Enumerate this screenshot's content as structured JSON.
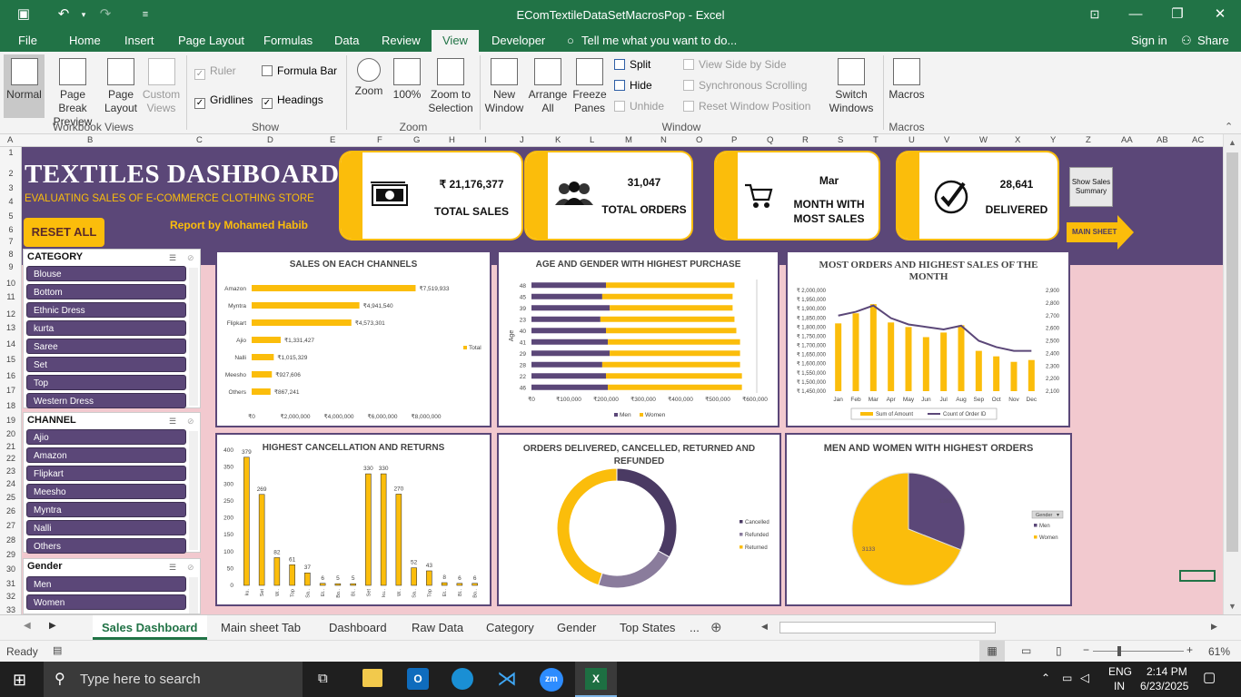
{
  "window": {
    "title": "EComTextileDataSetMacrosPop - Excel"
  },
  "menu": {
    "file": "File",
    "tabs": [
      "Home",
      "Insert",
      "Page Layout",
      "Formulas",
      "Data",
      "Review",
      "View",
      "Developer"
    ],
    "tell_me": "Tell me what you want to do...",
    "sign_in": "Sign in",
    "share": "Share"
  },
  "ribbon": {
    "normal": "Normal",
    "page_break": "Page Break Preview",
    "page_layout": "Page Layout",
    "custom_views": "Custom Views",
    "workbook_views": "Workbook Views",
    "ruler": "Ruler",
    "formula_bar": "Formula Bar",
    "gridlines": "Gridlines",
    "headings": "Headings",
    "show": "Show",
    "zoom": "Zoom",
    "zoom100": "100%",
    "zoom_sel": "Zoom to Selection",
    "zoom_grp": "Zoom",
    "new_window": "New Window",
    "arrange_all": "Arrange All",
    "freeze": "Freeze Panes",
    "split": "Split",
    "hide": "Hide",
    "unhide": "Unhide",
    "side_by_side": "View Side by Side",
    "sync_scroll": "Synchronous Scrolling",
    "reset_pos": "Reset Window Position",
    "switch_windows": "Switch Windows",
    "window_grp": "Window",
    "macros": "Macros",
    "macros_grp": "Macros"
  },
  "columns": [
    "A",
    "B",
    "C",
    "D",
    "E",
    "F",
    "G",
    "H",
    "I",
    "J",
    "K",
    "L",
    "M",
    "N",
    "O",
    "P",
    "Q",
    "R",
    "S",
    "T",
    "U",
    "V",
    "W",
    "X",
    "Y",
    "Z",
    "AA",
    "AB",
    "AC"
  ],
  "rows": [
    "1",
    "2",
    "3",
    "4",
    "5",
    "6",
    "7",
    "8",
    "9",
    "10",
    "11",
    "12",
    "13",
    "14",
    "15",
    "16",
    "17",
    "18",
    "19",
    "20",
    "21",
    "22",
    "23",
    "24",
    "25",
    "26",
    "27",
    "28",
    "29",
    "30",
    "31",
    "32",
    "33",
    "34",
    "35",
    "36",
    "37",
    "38",
    "39",
    "40"
  ],
  "dashboard": {
    "title": "TEXTILES DASHBOARD",
    "subtitle": "EVALUATING SALES OF E-COMMERCE  CLOTHING STORE",
    "reset": "RESET ALL",
    "author": "Report by Mohamed Habib",
    "kpis": [
      {
        "value": "₹ 21,176,377",
        "label": "TOTAL SALES",
        "icon": "money-icon"
      },
      {
        "value": "31,047",
        "label": "TOTAL ORDERS",
        "icon": "people-icon"
      },
      {
        "value": "Mar",
        "label": "MONTH WITH MOST SALES",
        "icon": "cart-icon"
      },
      {
        "value": "28,641",
        "label": "DELIVERED",
        "icon": "checkmark-icon"
      }
    ],
    "show_summary": "Show Sales Summary",
    "main_sheet": "MAIN SHEET"
  },
  "slicers": {
    "category": {
      "title": "CATEGORY",
      "items": [
        "Blouse",
        "Bottom",
        "Ethnic Dress",
        "kurta",
        "Saree",
        "Set",
        "Top",
        "Western Dress"
      ]
    },
    "channel": {
      "title": "CHANNEL",
      "items": [
        "Ajio",
        "Amazon",
        "Flipkart",
        "Meesho",
        "Myntra",
        "Nalli",
        "Others"
      ]
    },
    "gender": {
      "title": "Gender",
      "items": [
        "Men",
        "Women"
      ]
    }
  },
  "chart_data": [
    {
      "type": "bar",
      "title": "SALES ON EACH CHANNELS",
      "categories": [
        "Amazon",
        "Myntra",
        "Flipkart",
        "Ajio",
        "Nalli",
        "Meesho",
        "Others"
      ],
      "values": [
        7519933,
        4941540,
        4573301,
        1331427,
        1015329,
        927606,
        867241
      ],
      "labels": [
        "₹7,519,933",
        "₹4,941,540",
        "₹4,573,301",
        "₹1,331,427",
        "₹1,015,329",
        "₹927,606",
        "₹867,241"
      ],
      "xticks": [
        "₹0",
        "₹2,000,000",
        "₹4,000,000",
        "₹6,000,000",
        "₹8,000,000"
      ],
      "xlim": [
        0,
        8000000
      ],
      "legend": "Total",
      "color": "#fbbd0b"
    },
    {
      "type": "bar",
      "stacked": true,
      "title": "AGE AND GENDER WITH HIGHEST PURCHASE",
      "ylabel": "Age",
      "categories": [
        "48",
        "45",
        "39",
        "23",
        "40",
        "41",
        "29",
        "28",
        "22",
        "46"
      ],
      "series": [
        {
          "name": "Men",
          "values": [
            200000,
            190000,
            210000,
            185000,
            200000,
            205000,
            210000,
            190000,
            200000,
            205000
          ],
          "color": "#5b4778"
        },
        {
          "name": "Women",
          "values": [
            345000,
            350000,
            330000,
            360000,
            350000,
            355000,
            350000,
            370000,
            365000,
            360000
          ],
          "color": "#fbbd0b"
        }
      ],
      "xticks": [
        "₹0",
        "₹100,000",
        "₹200,000",
        "₹300,000",
        "₹400,000",
        "₹500,000",
        "₹600,000"
      ],
      "xlim": [
        0,
        600000
      ]
    },
    {
      "type": "bar+line",
      "title": "MOST ORDERS AND HIGHEST SALES OF THE MONTH",
      "categories": [
        "Jan",
        "Feb",
        "Mar",
        "Apr",
        "May",
        "Jun",
        "Jul",
        "Aug",
        "Sep",
        "Oct",
        "Nov",
        "Dec"
      ],
      "series": [
        {
          "name": "Sum of Amount",
          "values": [
            1820000,
            1875000,
            1925000,
            1825000,
            1800000,
            1745000,
            1770000,
            1810000,
            1670000,
            1640000,
            1610000,
            1620000
          ],
          "color": "#fbbd0b"
        },
        {
          "name": "Count of Order ID",
          "axis": "right",
          "values": [
            2700,
            2730,
            2780,
            2680,
            2630,
            2610,
            2590,
            2620,
            2500,
            2450,
            2420,
            2420
          ],
          "color": "#5b4778"
        }
      ],
      "yticks": [
        "₹ 2,000,000",
        "₹ 1,950,000",
        "₹ 1,900,000",
        "₹ 1,850,000",
        "₹ 1,800,000",
        "₹ 1,750,000",
        "₹ 1,700,000",
        "₹ 1,650,000",
        "₹ 1,600,000",
        "₹ 1,550,000",
        "₹ 1,500,000",
        "₹ 1,450,000"
      ],
      "ylim": [
        1450000,
        2000000
      ],
      "y2ticks": [
        "2,900",
        "2,800",
        "2,700",
        "2,600",
        "2,500",
        "2,400",
        "2,300",
        "2,200",
        "2,100"
      ],
      "y2lim": [
        2100,
        2900
      ]
    },
    {
      "type": "bar",
      "title": "HIGHEST CANCELLATION AND RETURNS",
      "categories": [
        "ku.",
        "Set",
        "W..",
        "Top",
        "Sa..",
        "Et..",
        "Bo..",
        "Bl..",
        "Set",
        "ku..",
        "W..",
        "Sa..",
        "Top",
        "Et..",
        "Bl..",
        "Bo.."
      ],
      "values": [
        379,
        269,
        82,
        61,
        37,
        6,
        5,
        5,
        330,
        330,
        270,
        52,
        43,
        8,
        6,
        6
      ],
      "yticks": [
        "400",
        "350",
        "300",
        "250",
        "200",
        "150",
        "100",
        "50",
        "0"
      ],
      "ylim": [
        0,
        400
      ],
      "color": "#fbbd0b"
    },
    {
      "type": "pie",
      "donut": true,
      "title": "ORDERS DELIVERED, CANCELLED, RETURNED AND REFUNDED",
      "categories": [
        "Cancelled",
        "Refunded",
        "Returned"
      ],
      "values": [
        0.33,
        0.22,
        0.45
      ],
      "colors": [
        "#4a3a63",
        "#8a7c9c",
        "#fbbd0b"
      ]
    },
    {
      "type": "pie",
      "title": "MEN AND WOMEN WITH HIGHEST ORDERS",
      "legend_title": "Gender",
      "categories": [
        "Men",
        "Women"
      ],
      "values": [
        0.31,
        0.69
      ],
      "labels": [
        "1388",
        "3133"
      ],
      "colors": [
        "#5b4778",
        "#fbbd0b"
      ]
    }
  ],
  "sheet_tabs": [
    "Sales Dashboard",
    "Main sheet Tab",
    "Dashboard",
    "Raw Data",
    "Category",
    "Gender",
    "Top States",
    "..."
  ],
  "status": {
    "ready": "Ready",
    "zoom": "61%"
  },
  "taskbar": {
    "search": "Type here to search",
    "lang1": "ENG",
    "lang2": "IN",
    "time": "2:14 PM",
    "date": "6/23/2025"
  }
}
